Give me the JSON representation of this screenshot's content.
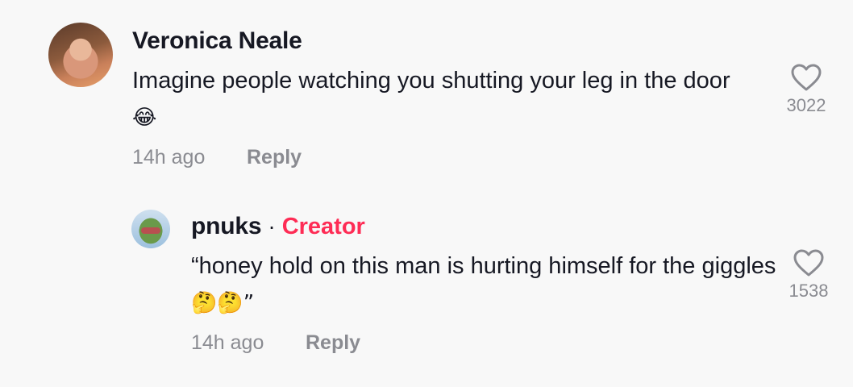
{
  "comments": [
    {
      "username": "Veronica Neale",
      "text": "Imagine people watching you shutting your leg in the door",
      "emoji": "😂",
      "time": "14h ago",
      "reply_label": "Reply",
      "likes": "3022"
    },
    {
      "username": "pnuks",
      "separator": "·",
      "badge": "Creator",
      "text": "“honey hold on this man is hurting himself for the giggles",
      "emoji": "🤔🤔”",
      "time": "14h ago",
      "reply_label": "Reply",
      "likes": "1538"
    }
  ],
  "colors": {
    "creator": "#fe2c55",
    "meta": "#8a8b91",
    "text": "#161823"
  },
  "icons": {
    "like": "heart-outline-icon"
  }
}
